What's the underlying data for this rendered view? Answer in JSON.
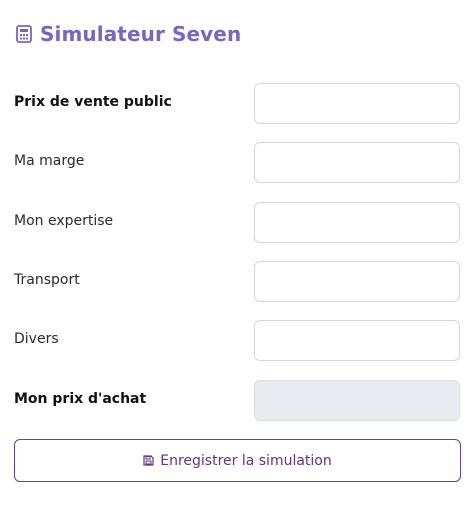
{
  "header": {
    "title": "Simulateur Seven",
    "icon": "calculator-icon",
    "accent_color": "#7a64c0"
  },
  "form": {
    "fields": [
      {
        "label": "Prix de vente public",
        "value": "",
        "bold": true
      },
      {
        "label": "Ma marge",
        "value": "",
        "bold": false
      },
      {
        "label": "Mon expertise",
        "value": "",
        "bold": false
      },
      {
        "label": "Transport",
        "value": "",
        "bold": false
      },
      {
        "label": "Divers",
        "value": "",
        "bold": false
      },
      {
        "label": "Mon prix d'achat",
        "value": "",
        "bold": true,
        "readonly": true
      }
    ]
  },
  "actions": {
    "save_label": "Enregistrer la simulation",
    "save_icon": "floppy-disk-icon",
    "button_color": "#5e3582"
  }
}
